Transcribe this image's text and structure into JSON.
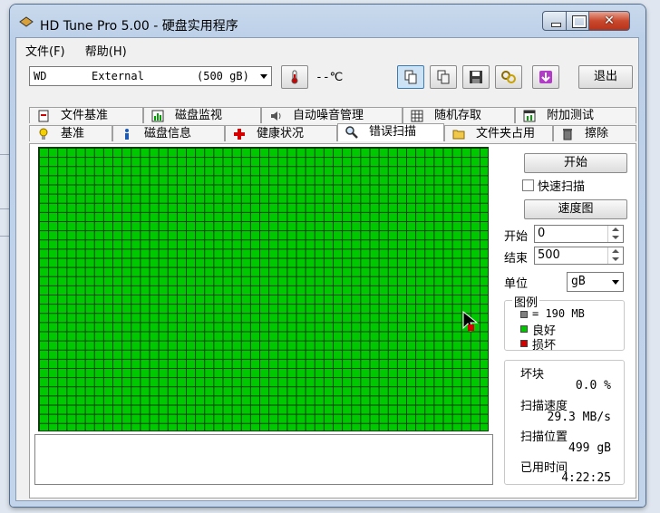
{
  "window": {
    "title": "HD Tune Pro 5.00 - 硬盘实用程序",
    "close_glyph": "✕"
  },
  "menu": [
    "文件(F)",
    "帮助(H)"
  ],
  "toolbar": {
    "drive": {
      "vendor": "WD",
      "model": "External",
      "size": "(500 gB)"
    },
    "temperature": "--℃",
    "exit_label": "退出"
  },
  "tabs_top": [
    "文件基准",
    "磁盘监视",
    "自动噪音管理",
    "随机存取",
    "附加测试"
  ],
  "tabs_bottom": [
    "基准",
    "磁盘信息",
    "健康状况",
    "错误扫描",
    "文件夹占用",
    "擦除"
  ],
  "selected_tab": "错误扫描",
  "side": {
    "start_button": "开始",
    "quick_scan_label": "快速扫描",
    "quick_scan_checked": false,
    "speed_map_button": "速度图",
    "start_label": "开始",
    "start_value": "0",
    "end_label": "结束",
    "end_value": "500",
    "unit_label": "单位",
    "unit_value": "gB",
    "legend_title": "图例",
    "legend_block": "= 190 MB",
    "legend_good": "良好",
    "legend_bad": "损坏",
    "stats": {
      "bad_blocks_label": "坏块",
      "bad_blocks_value": "0.0 %",
      "scan_speed_label": "扫描速度",
      "scan_speed_value": "29.3 MB/s",
      "scan_position_label": "扫描位置",
      "scan_position_value": "499 gB",
      "elapsed_label": "已用时间",
      "elapsed_value": "4:22:25"
    }
  },
  "colors": {
    "good": "#00c800",
    "bad": "#d40000",
    "block": "#808080",
    "grid_line": "#0a3d0a"
  }
}
